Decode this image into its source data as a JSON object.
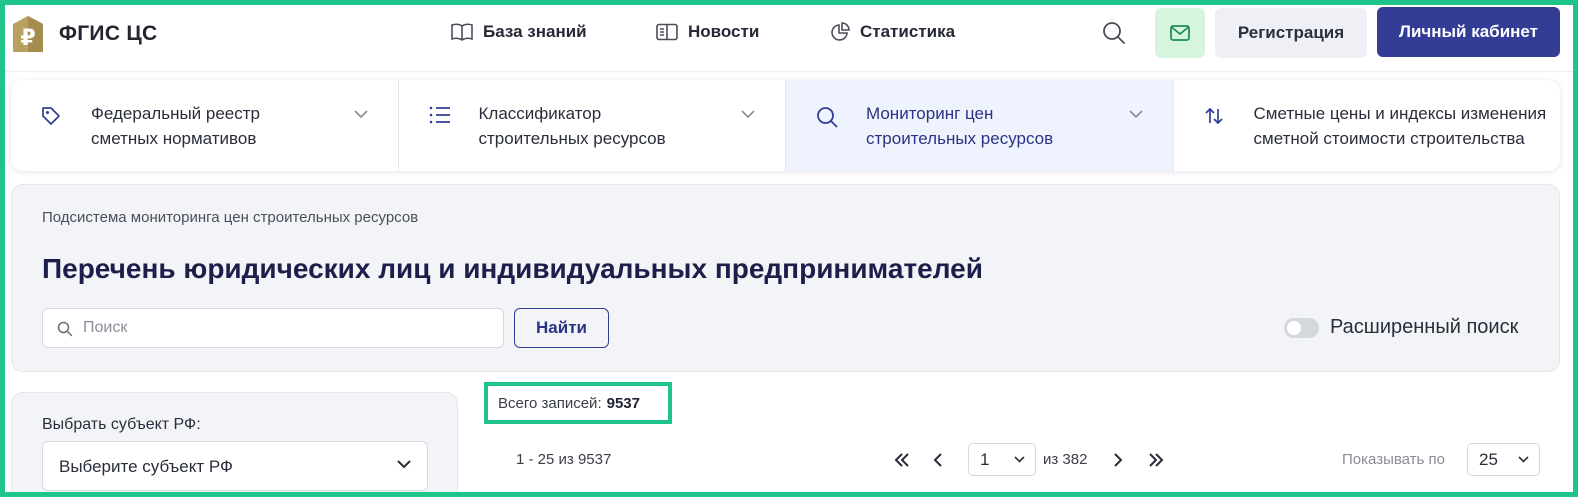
{
  "header": {
    "brand": "ФГИС ЦС",
    "logo_letter": "₽",
    "nav": [
      {
        "label": "База знаний",
        "icon": "book-icon"
      },
      {
        "label": "Новости",
        "icon": "newspaper-icon"
      },
      {
        "label": "Статистика",
        "icon": "pie-chart-icon"
      }
    ],
    "register_label": "Регистрация",
    "cabinet_label": "Личный кабинет"
  },
  "categories": [
    {
      "line1": "Федеральный реестр",
      "line2": "сметных нормативов",
      "icon": "tag-icon"
    },
    {
      "line1": "Классификатор",
      "line2": "строительных ресурсов",
      "icon": "list-icon"
    },
    {
      "line1": "Мониторинг цен",
      "line2": "строительных ресурсов",
      "icon": "search-icon",
      "active": true
    },
    {
      "line1": "Сметные цены и индексы изменения",
      "line2": "сметной стоимости строительства",
      "icon": "sort-arrows-icon"
    }
  ],
  "panel": {
    "breadcrumb": "Подсистема мониторинга цен строительных ресурсов",
    "title": "Перечень юридических лиц и индивидуальных предпринимателей",
    "search_placeholder": "Поиск",
    "search_value": "",
    "find_label": "Найти",
    "advanced_label": "Расширенный поиск",
    "advanced_enabled": false
  },
  "filter": {
    "label": "Выбрать субъект РФ:",
    "selected": "Выберите субъект РФ"
  },
  "results": {
    "total_label": "Всего записей:",
    "total_value": "9537",
    "range": "1 - 25 из 9537",
    "current_page": "1",
    "of_pages": "из 382",
    "show_label": "Показывать по",
    "page_size": "25"
  },
  "colors": {
    "accent": "#343d96",
    "highlight": "#1fc48a",
    "active_tab_bg": "#eef3fd",
    "mail_bg": "#d6f5df",
    "logo_gold": "#b8a061"
  }
}
